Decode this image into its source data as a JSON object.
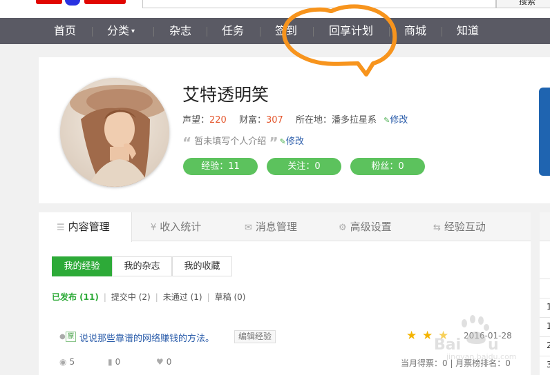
{
  "top": {
    "search_button": "搜索"
  },
  "nav": {
    "items": [
      {
        "label": "首页"
      },
      {
        "label": "分类"
      },
      {
        "label": "杂志"
      },
      {
        "label": "任务"
      },
      {
        "label": "签到"
      },
      {
        "label": "回享计划"
      },
      {
        "label": "商城"
      },
      {
        "label": "知道"
      }
    ]
  },
  "profile": {
    "name": "艾特透明笑",
    "reputation_label": "声望：",
    "reputation": "220",
    "wealth_label": "财富：",
    "wealth": "307",
    "location_label": "所在地：",
    "location": "潘多拉星系",
    "edit_label": "修改",
    "bio": "暂未填写个人介绍",
    "pills": [
      {
        "label": "经验：11"
      },
      {
        "label": "关注：0"
      },
      {
        "label": "粉丝：0"
      }
    ]
  },
  "tabs": [
    {
      "label": "内容管理",
      "icon": "list-icon"
    },
    {
      "label": "收入统计",
      "icon": "yen-icon"
    },
    {
      "label": "消息管理",
      "icon": "mail-icon"
    },
    {
      "label": "高级设置",
      "icon": "gear-icon"
    },
    {
      "label": "经验互动",
      "icon": "swap-icon"
    }
  ],
  "subtabs": [
    {
      "label": "我的经验"
    },
    {
      "label": "我的杂志"
    },
    {
      "label": "我的收藏"
    }
  ],
  "filters": [
    {
      "label": "已发布 (11)"
    },
    {
      "label": "提交中 (2)"
    },
    {
      "label": "未通过 (1)"
    },
    {
      "label": "草稿 (0)"
    }
  ],
  "article": {
    "badge": "原",
    "title": "说说那些靠谱的网络赚钱的方法。",
    "edit_button": "编辑经验",
    "date": "2016-01-28",
    "views": "5",
    "votes": "0",
    "likes": "0",
    "rank_text": "当月得票：0 | 月票榜排名：0"
  },
  "sidebar_numbers": [
    "1",
    "1",
    "2",
    "3"
  ],
  "colors": {
    "nav_bg": "#5a5a64",
    "accent_green": "#5cc25d",
    "annotation_orange": "#f7941d",
    "link_blue": "#2a5caa",
    "stat_orange": "#e4572e"
  }
}
